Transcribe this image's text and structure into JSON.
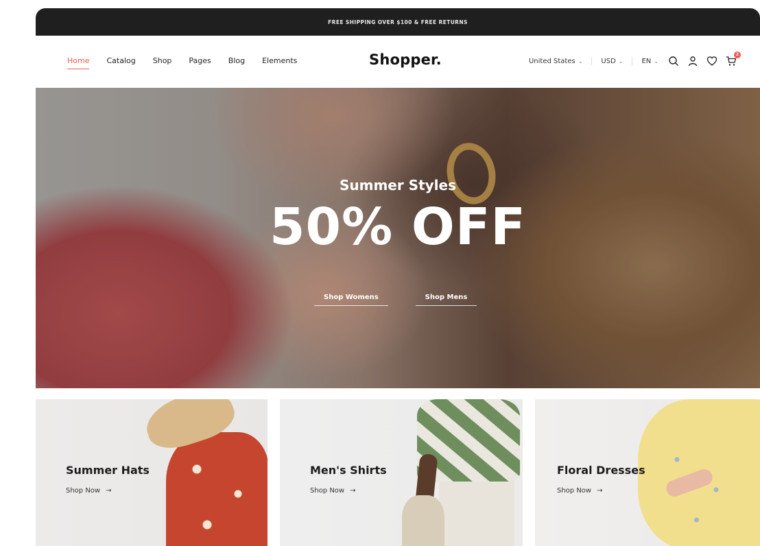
{
  "announcement": {
    "text": "FREE SHIPPING OVER $100 & FREE RETURNS"
  },
  "header": {
    "nav": [
      "Home",
      "Catalog",
      "Shop",
      "Pages",
      "Blog",
      "Elements"
    ],
    "active_nav": "Home",
    "logo": "Shopper.",
    "country": "United States",
    "currency": "USD",
    "language": "EN",
    "cart_count": "2",
    "icons": [
      "search-icon",
      "user-icon",
      "heart-icon",
      "cart-icon"
    ]
  },
  "hero": {
    "subtitle": "Summer Styles",
    "title": "50% OFF",
    "links": [
      "Shop Womens",
      "Shop Mens"
    ]
  },
  "categories": [
    {
      "title": "Summer Hats",
      "link": "Shop Now",
      "arrow": "→"
    },
    {
      "title": "Men's Shirts",
      "link": "Shop Now",
      "arrow": "→"
    },
    {
      "title": "Floral Dresses",
      "link": "Shop Now",
      "arrow": "→"
    }
  ],
  "colors": {
    "accent": "#f05a52",
    "topbar": "#1f1f1f",
    "text": "#111111"
  }
}
